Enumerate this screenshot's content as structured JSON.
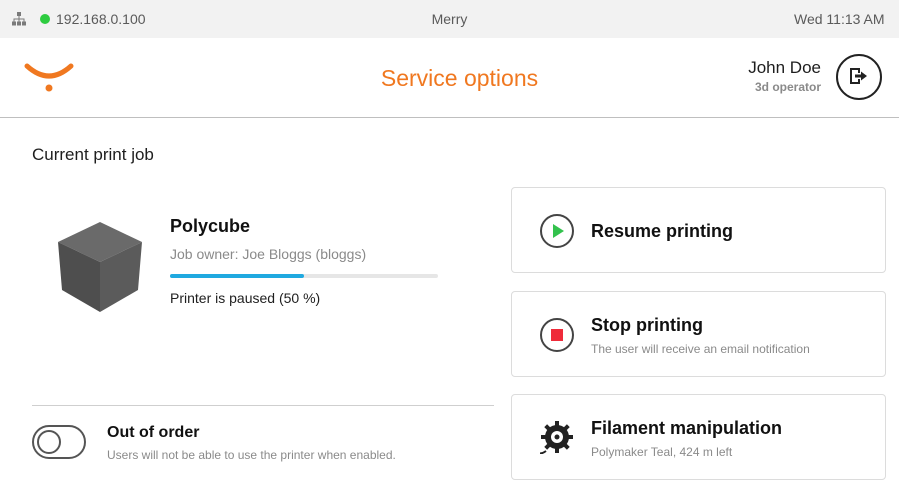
{
  "status_bar": {
    "ip": "192.168.0.100",
    "host": "Merry",
    "datetime": "Wed 11:13 AM",
    "online_color": "#2ecc40"
  },
  "header": {
    "title": "Service options",
    "brand_color": "#f07820",
    "user_name": "John Doe",
    "user_role": "3d operator"
  },
  "job": {
    "section_label": "Current print job",
    "name": "Polycube",
    "owner": "Job owner: Joe Bloggs (bloggs)",
    "progress_fraction": 0.5,
    "status": "Printer is paused (50 %)"
  },
  "out_of_order": {
    "title": "Out of order",
    "description": "Users will not be able to use the printer when enabled.",
    "enabled": false
  },
  "actions": [
    {
      "icon": "play-icon",
      "title": "Resume printing",
      "subtitle": ""
    },
    {
      "icon": "stop-icon",
      "title": "Stop printing",
      "subtitle": "The user will receive an email notification"
    },
    {
      "icon": "filament-icon",
      "title": "Filament manipulation",
      "subtitle": "Polymaker Teal, 424 m left"
    }
  ]
}
